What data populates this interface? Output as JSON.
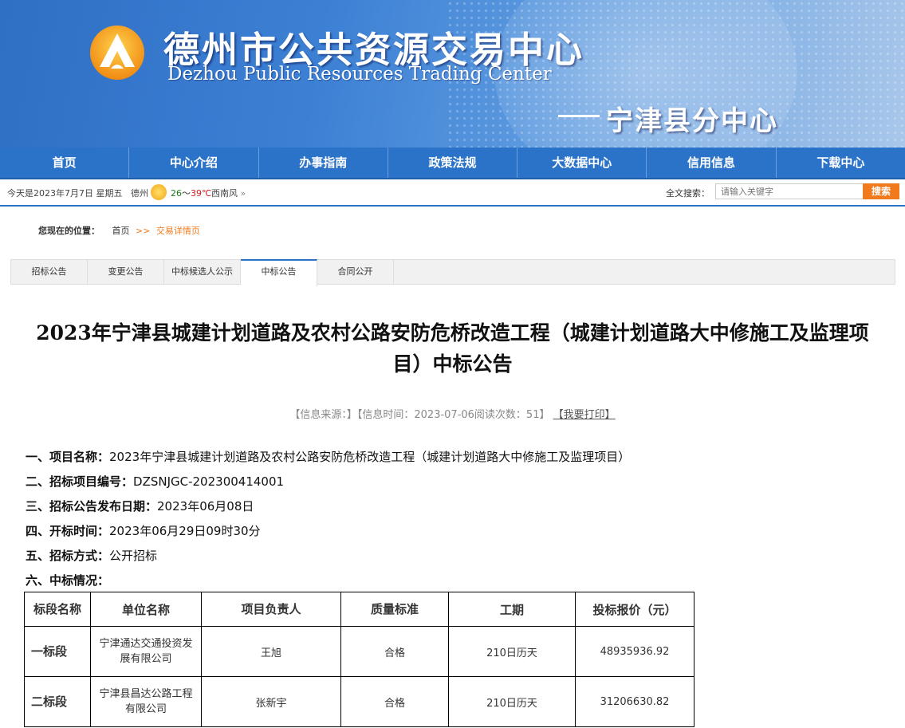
{
  "header": {
    "title_cn": "德州市公共资源交易中心",
    "title_en": "Dezhou Public Resources Trading Center",
    "subtitle": "宁津县分中心"
  },
  "nav": {
    "items": [
      "首页",
      "中心介绍",
      "办事指南",
      "政策法规",
      "大数据中心",
      "信用信息",
      "下载中心"
    ]
  },
  "infobar": {
    "today": "今天是2023年7月7日 星期五",
    "city": "德州",
    "temp_low": "26",
    "temp_sep": "～",
    "temp_high": "39℃",
    "wind": "西南风",
    "search_label": "全文搜索：",
    "search_placeholder": "请输入关键字",
    "search_button": "搜索"
  },
  "breadcrumb": {
    "label": "您现在的位置：",
    "home": "首页",
    "sep": ">>",
    "current": "交易详情页"
  },
  "tabs": [
    "招标公告",
    "变更公告",
    "中标候选人公示",
    "中标公告",
    "合同公开"
  ],
  "active_tab": "中标公告",
  "article": {
    "title": "2023年宁津县城建计划道路及农村公路安防危桥改造工程（城建计划道路大中修施工及监理项目）中标公告",
    "meta": "【信息来源：】【信息时间：2023-07-06阅读次数：51】",
    "print": "【我要打印】",
    "fields": [
      {
        "label": "一、项目名称：",
        "value": "2023年宁津县城建计划道路及农村公路安防危桥改造工程（城建计划道路大中修施工及监理项目）"
      },
      {
        "label": "二、招标项目编号：",
        "value": "DZSNJGC-202300414001"
      },
      {
        "label": "三、招标公告发布日期：",
        "value": "2023年06月08日"
      },
      {
        "label": "四、开标时间：",
        "value": "2023年06月29日09时30分"
      },
      {
        "label": "五、招标方式：",
        "value": "公开招标"
      },
      {
        "label": "六、中标情况：",
        "value": ""
      }
    ]
  },
  "table": {
    "headers": [
      "标段名称",
      "单位名称",
      "项目负责人",
      "质量标准",
      "工期",
      "投标报价（元）"
    ],
    "rows": [
      [
        "一标段",
        "宁津通达交通投资发展有限公司",
        "王旭",
        "合格",
        "210日历天",
        "48935936.92"
      ],
      [
        "二标段",
        "宁津县昌达公路工程有限公司",
        "张新宇",
        "合格",
        "210日历天",
        "31206630.82"
      ]
    ]
  }
}
